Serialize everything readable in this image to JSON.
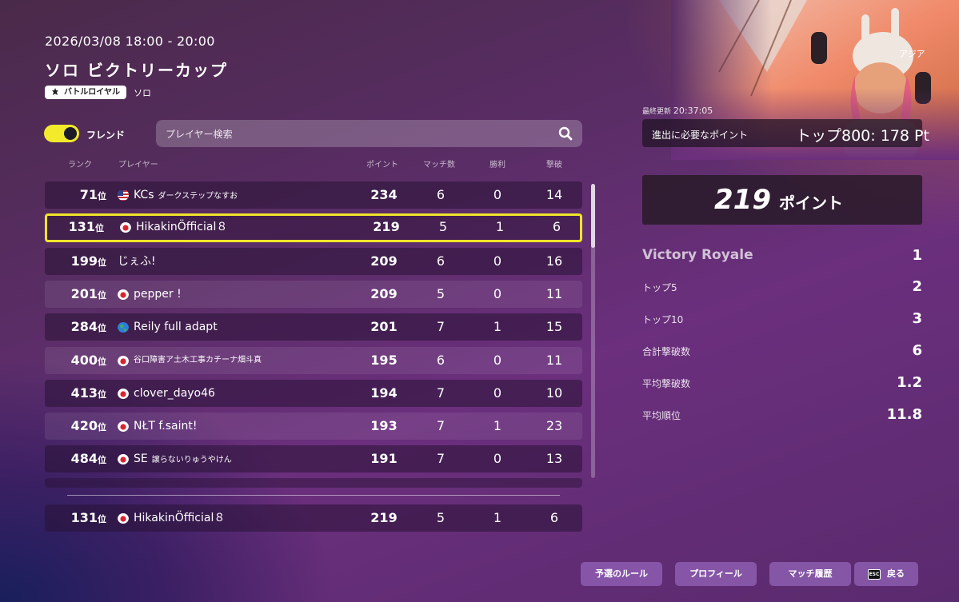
{
  "header": {
    "datetime": "2026/03/08 18:00 - 20:00",
    "title": "ソロ ビクトリーカップ",
    "mode_badge": "バトルロイヤル",
    "mode_sub": "ソロ"
  },
  "filters": {
    "friend_toggle_label": "フレンド",
    "friend_toggle_on": true,
    "search_placeholder": "プレイヤー検索"
  },
  "table": {
    "headers": {
      "rank": "ランク",
      "player": "プレイヤー",
      "points": "ポイント",
      "matches": "マッチ数",
      "wins": "勝利",
      "elims": "撃破"
    },
    "rows": [
      {
        "rank": "71",
        "rank_suffix": "位",
        "flag": "flag-us-icon",
        "name": "KCs",
        "name_jp": "ダークステップなすお",
        "points": "234",
        "matches": "6",
        "wins": "0",
        "elims": "14"
      },
      {
        "rank": "131",
        "rank_suffix": "位",
        "flag": "flag-jp-icon",
        "name": "HikakinÖfficial８",
        "name_jp": "",
        "points": "219",
        "matches": "5",
        "wins": "1",
        "elims": "6"
      },
      {
        "rank": "199",
        "rank_suffix": "位",
        "flag": "",
        "name": "じぇふ!",
        "name_jp": "",
        "points": "209",
        "matches": "6",
        "wins": "0",
        "elims": "16"
      },
      {
        "rank": "201",
        "rank_suffix": "位",
        "flag": "flag-jp-icon",
        "name": "pepper !",
        "name_jp": "",
        "points": "209",
        "matches": "5",
        "wins": "0",
        "elims": "11"
      },
      {
        "rank": "284",
        "rank_suffix": "位",
        "flag": "globe-icon",
        "name": "Reily full adapt",
        "name_jp": "",
        "points": "201",
        "matches": "7",
        "wins": "1",
        "elims": "15"
      },
      {
        "rank": "400",
        "rank_suffix": "位",
        "flag": "flag-jp-icon",
        "name": "",
        "name_jp": "谷口障害ア土木工事カチーナ畑斗真",
        "points": "195",
        "matches": "6",
        "wins": "0",
        "elims": "11"
      },
      {
        "rank": "413",
        "rank_suffix": "位",
        "flag": "flag-jp-icon",
        "name": "clover_dayo46",
        "name_jp": "",
        "points": "194",
        "matches": "7",
        "wins": "0",
        "elims": "10"
      },
      {
        "rank": "420",
        "rank_suffix": "位",
        "flag": "flag-jp-icon",
        "name": "NŁT f.saint!",
        "name_jp": "",
        "points": "193",
        "matches": "7",
        "wins": "1",
        "elims": "23"
      },
      {
        "rank": "484",
        "rank_suffix": "位",
        "flag": "flag-jp-icon",
        "name": "SE",
        "name_jp": "譲らないりゅうやけん",
        "points": "191",
        "matches": "7",
        "wins": "0",
        "elims": "13"
      }
    ],
    "self_row": {
      "rank": "131",
      "rank_suffix": "位",
      "flag": "flag-jp-icon",
      "name": "HikakinÖfficial８",
      "points": "219",
      "matches": "5",
      "wins": "1",
      "elims": "6"
    }
  },
  "side": {
    "region": "アジア",
    "updated_label": "最終更新",
    "updated_time": "20:37:05",
    "required_label": "進出に必要なポイント",
    "required_value": "トップ800: 178 Pt",
    "points_value": "219",
    "points_unit": "ポイント",
    "stats": [
      {
        "label": "Victory Royale",
        "value": "1"
      },
      {
        "label": "トップ5",
        "value": "2"
      },
      {
        "label": "トップ10",
        "value": "3"
      },
      {
        "label": "合計撃破数",
        "value": "6"
      },
      {
        "label": "平均撃破数",
        "value": "1.2"
      },
      {
        "label": "平均順位",
        "value": "11.8"
      }
    ]
  },
  "buttons": {
    "rules": "予選のルール",
    "profile": "プロフィール",
    "history": "マッチ履歴",
    "back_key": "ESC",
    "back": "戻る"
  },
  "colors": {
    "highlight": "#f0e42a",
    "toggle": "#f2ea2b"
  }
}
